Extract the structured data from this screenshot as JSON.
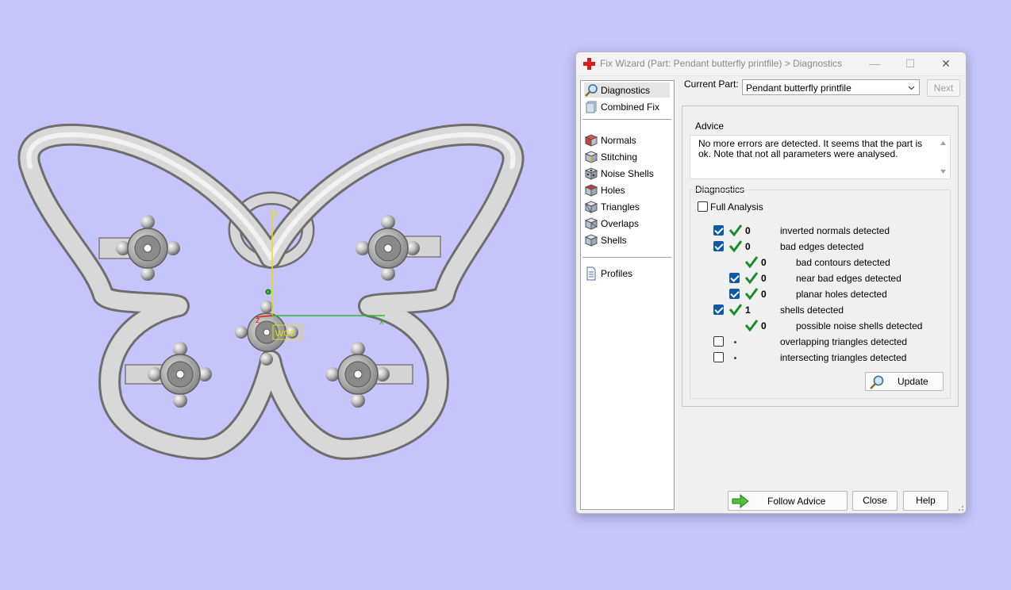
{
  "window": {
    "title": "Fix Wizard (Part: Pendant butterfly printfile) > Diagnostics",
    "minimize_glyph": "—",
    "maximize_glyph": "☐",
    "close_glyph": "✕"
  },
  "sidebar": {
    "items": [
      {
        "label": "Diagnostics",
        "icon": "magnifier-icon"
      },
      {
        "label": "Combined Fix",
        "icon": "combined-fix-icon"
      },
      {
        "label": "Normals",
        "icon": "normals-cube-icon"
      },
      {
        "label": "Stitching",
        "icon": "stitching-cube-icon"
      },
      {
        "label": "Noise Shells",
        "icon": "noise-shells-icon"
      },
      {
        "label": "Holes",
        "icon": "holes-cube-icon"
      },
      {
        "label": "Triangles",
        "icon": "triangles-cube-icon"
      },
      {
        "label": "Overlaps",
        "icon": "overlaps-cube-icon"
      },
      {
        "label": "Shells",
        "icon": "shells-cube-icon"
      },
      {
        "label": "Profiles",
        "icon": "profiles-document-icon"
      }
    ],
    "selected": "Diagnostics"
  },
  "current_part": {
    "label": "Current Part:",
    "value": "Pendant butterfly printfile",
    "next_label": "Next"
  },
  "advice": {
    "title": "Advice",
    "text": "No more errors are detected. It seems that the part is ok. Note that not all parameters were analysed."
  },
  "diagnostics": {
    "title": "Diagnostics",
    "full_analysis_label": "Full Analysis",
    "full_analysis_checked": false,
    "rows": [
      {
        "count": "0",
        "label": "inverted normals detected",
        "checkbox": true,
        "checked": true,
        "status": "ok",
        "indent": 0
      },
      {
        "count": "0",
        "label": "bad edges detected",
        "checkbox": true,
        "checked": true,
        "status": "ok",
        "indent": 0
      },
      {
        "count": "0",
        "label": "bad contours detected",
        "checkbox": false,
        "checked": false,
        "status": "ok",
        "indent": 1
      },
      {
        "count": "0",
        "label": "near bad edges detected",
        "checkbox": true,
        "checked": true,
        "status": "ok",
        "indent": 1
      },
      {
        "count": "0",
        "label": "planar holes detected",
        "checkbox": true,
        "checked": true,
        "status": "ok",
        "indent": 1
      },
      {
        "count": "1",
        "label": "shells detected",
        "checkbox": true,
        "checked": true,
        "status": "ok",
        "indent": 0
      },
      {
        "count": "0",
        "label": "possible noise shells detected",
        "checkbox": false,
        "checked": false,
        "status": "ok",
        "indent": 1
      },
      {
        "count": "",
        "label": "overlapping triangles detected",
        "checkbox": true,
        "checked": false,
        "status": "not-analysed",
        "indent": 0
      },
      {
        "count": "",
        "label": "intersecting triangles detected",
        "checkbox": true,
        "checked": false,
        "status": "not-analysed",
        "indent": 0
      }
    ],
    "update_label": "Update"
  },
  "footer": {
    "follow_advice_label": "Follow Advice",
    "close_label": "Close",
    "help_label": "Help"
  },
  "viewport": {
    "axis_x_label": "x",
    "axis_y_label": "y",
    "axis_z_label": "z",
    "wcs_label": "WCS",
    "background_color": "#c5c5fb",
    "model_color": "#d0d0d0"
  }
}
